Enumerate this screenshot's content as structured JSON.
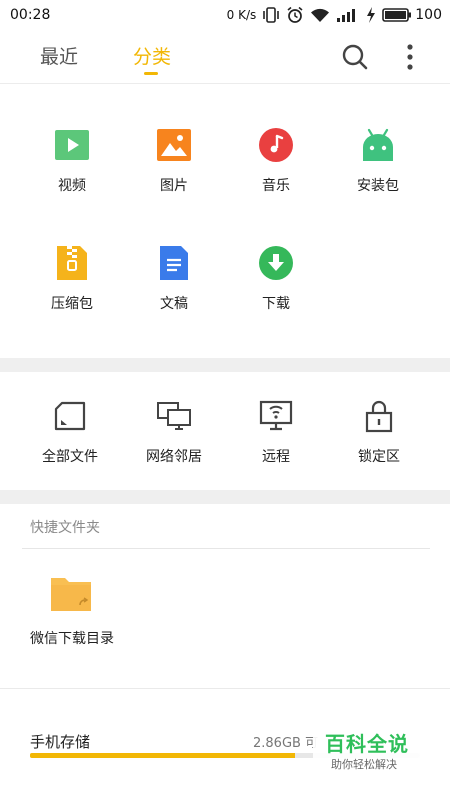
{
  "status_bar": {
    "time": "00:28",
    "net_speed": "0 K/s",
    "battery": "100"
  },
  "tabs": [
    {
      "label": "最近",
      "active": false
    },
    {
      "label": "分类",
      "active": true
    }
  ],
  "accent_color": "#f2b705",
  "categories": [
    {
      "label": "视频",
      "icon": "video-icon",
      "color": "#5cc77a"
    },
    {
      "label": "图片",
      "icon": "image-icon",
      "color": "#f7841e"
    },
    {
      "label": "音乐",
      "icon": "music-icon",
      "color": "#e94040"
    },
    {
      "label": "安装包",
      "icon": "android-icon",
      "color": "#3fc27f"
    },
    {
      "label": "压缩包",
      "icon": "archive-icon",
      "color": "#f5b31b"
    },
    {
      "label": "文稿",
      "icon": "document-icon",
      "color": "#3a7bea"
    },
    {
      "label": "下载",
      "icon": "download-icon",
      "color": "#35b85a"
    }
  ],
  "tools": [
    {
      "label": "全部文件",
      "icon": "sd-card-icon"
    },
    {
      "label": "网络邻居",
      "icon": "network-devices-icon"
    },
    {
      "label": "远程",
      "icon": "remote-monitor-icon"
    },
    {
      "label": "锁定区",
      "icon": "lock-icon"
    }
  ],
  "quick_access": {
    "title": "快捷文件夹",
    "folders": [
      {
        "label": "微信下载目录",
        "icon": "folder-icon"
      }
    ]
  },
  "storage": {
    "label": "手机存储",
    "size_text": "2.86GB 可",
    "used_fraction": 0.68
  },
  "watermark": {
    "title": "百科全说",
    "subtitle": "助你轻松解决"
  }
}
